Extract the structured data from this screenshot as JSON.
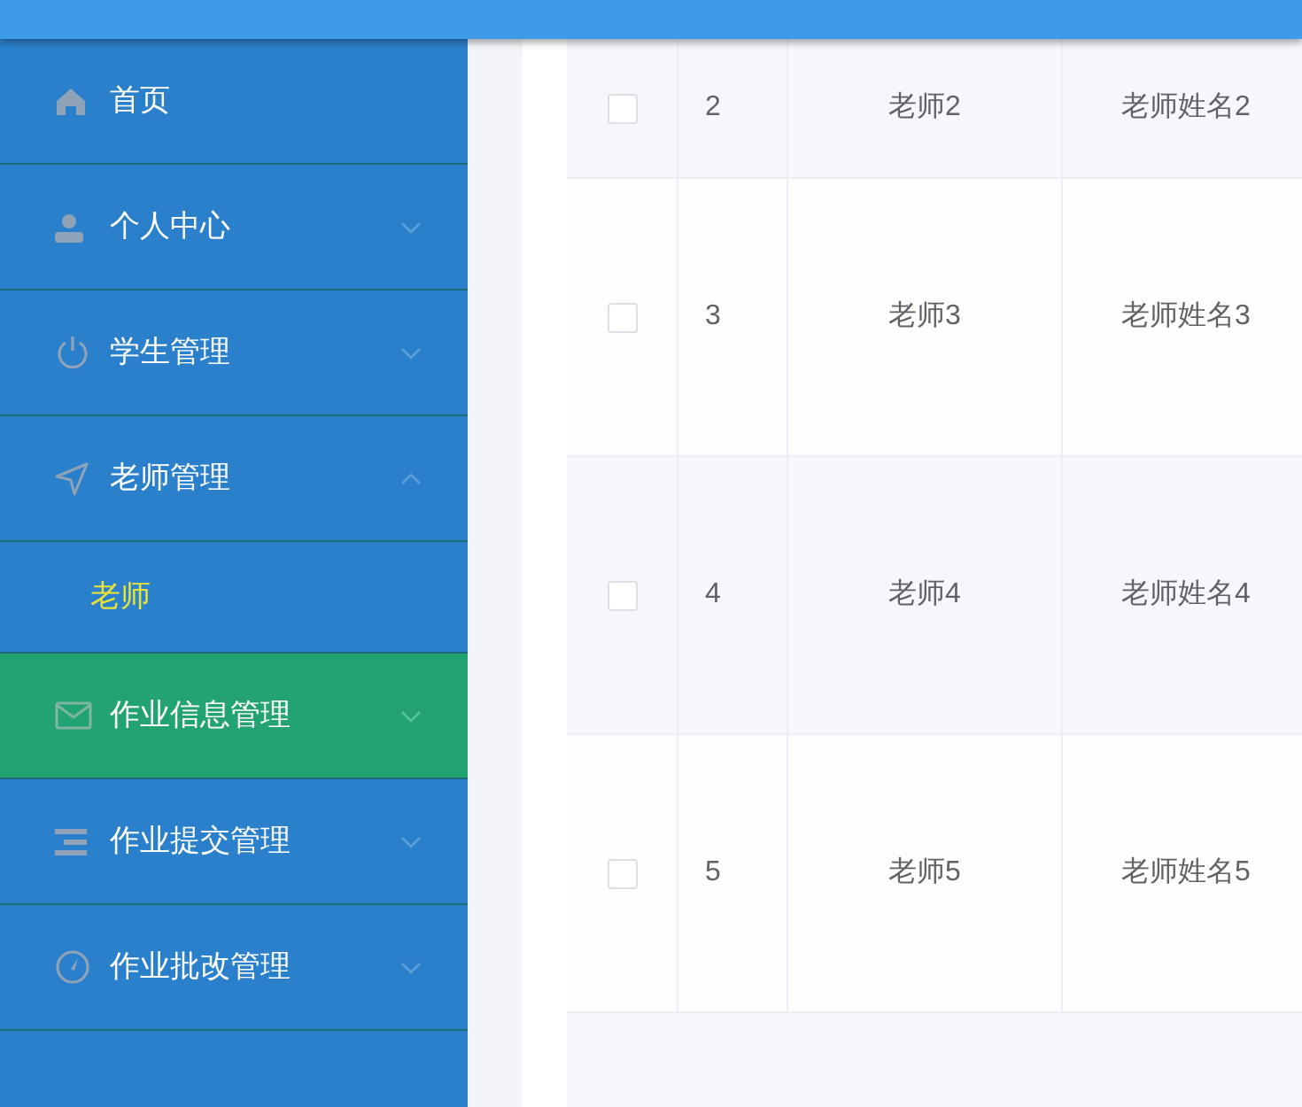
{
  "sidebar": {
    "items": [
      {
        "label": "首页",
        "highlighted": false
      },
      {
        "label": "个人中心",
        "highlighted": false,
        "expanded": false
      },
      {
        "label": "学生管理",
        "highlighted": false,
        "expanded": false
      },
      {
        "label": "老师管理",
        "highlighted": false,
        "expanded": true,
        "children": [
          {
            "label": "老师",
            "selected": true
          }
        ]
      },
      {
        "label": "作业信息管理",
        "highlighted": true,
        "expanded": false
      },
      {
        "label": "作业提交管理",
        "highlighted": false,
        "expanded": false
      },
      {
        "label": "作业批改管理",
        "highlighted": false,
        "expanded": false
      }
    ]
  },
  "table": {
    "rows": [
      {
        "checked": false,
        "cells": [
          "2",
          "老师2",
          "老师姓名2"
        ]
      },
      {
        "checked": false,
        "cells": [
          "3",
          "老师3",
          "老师姓名3"
        ]
      },
      {
        "checked": false,
        "cells": [
          "4",
          "老师4",
          "老师姓名4"
        ]
      },
      {
        "checked": false,
        "cells": [
          "5",
          "老师5",
          "老师姓名5"
        ]
      }
    ]
  }
}
